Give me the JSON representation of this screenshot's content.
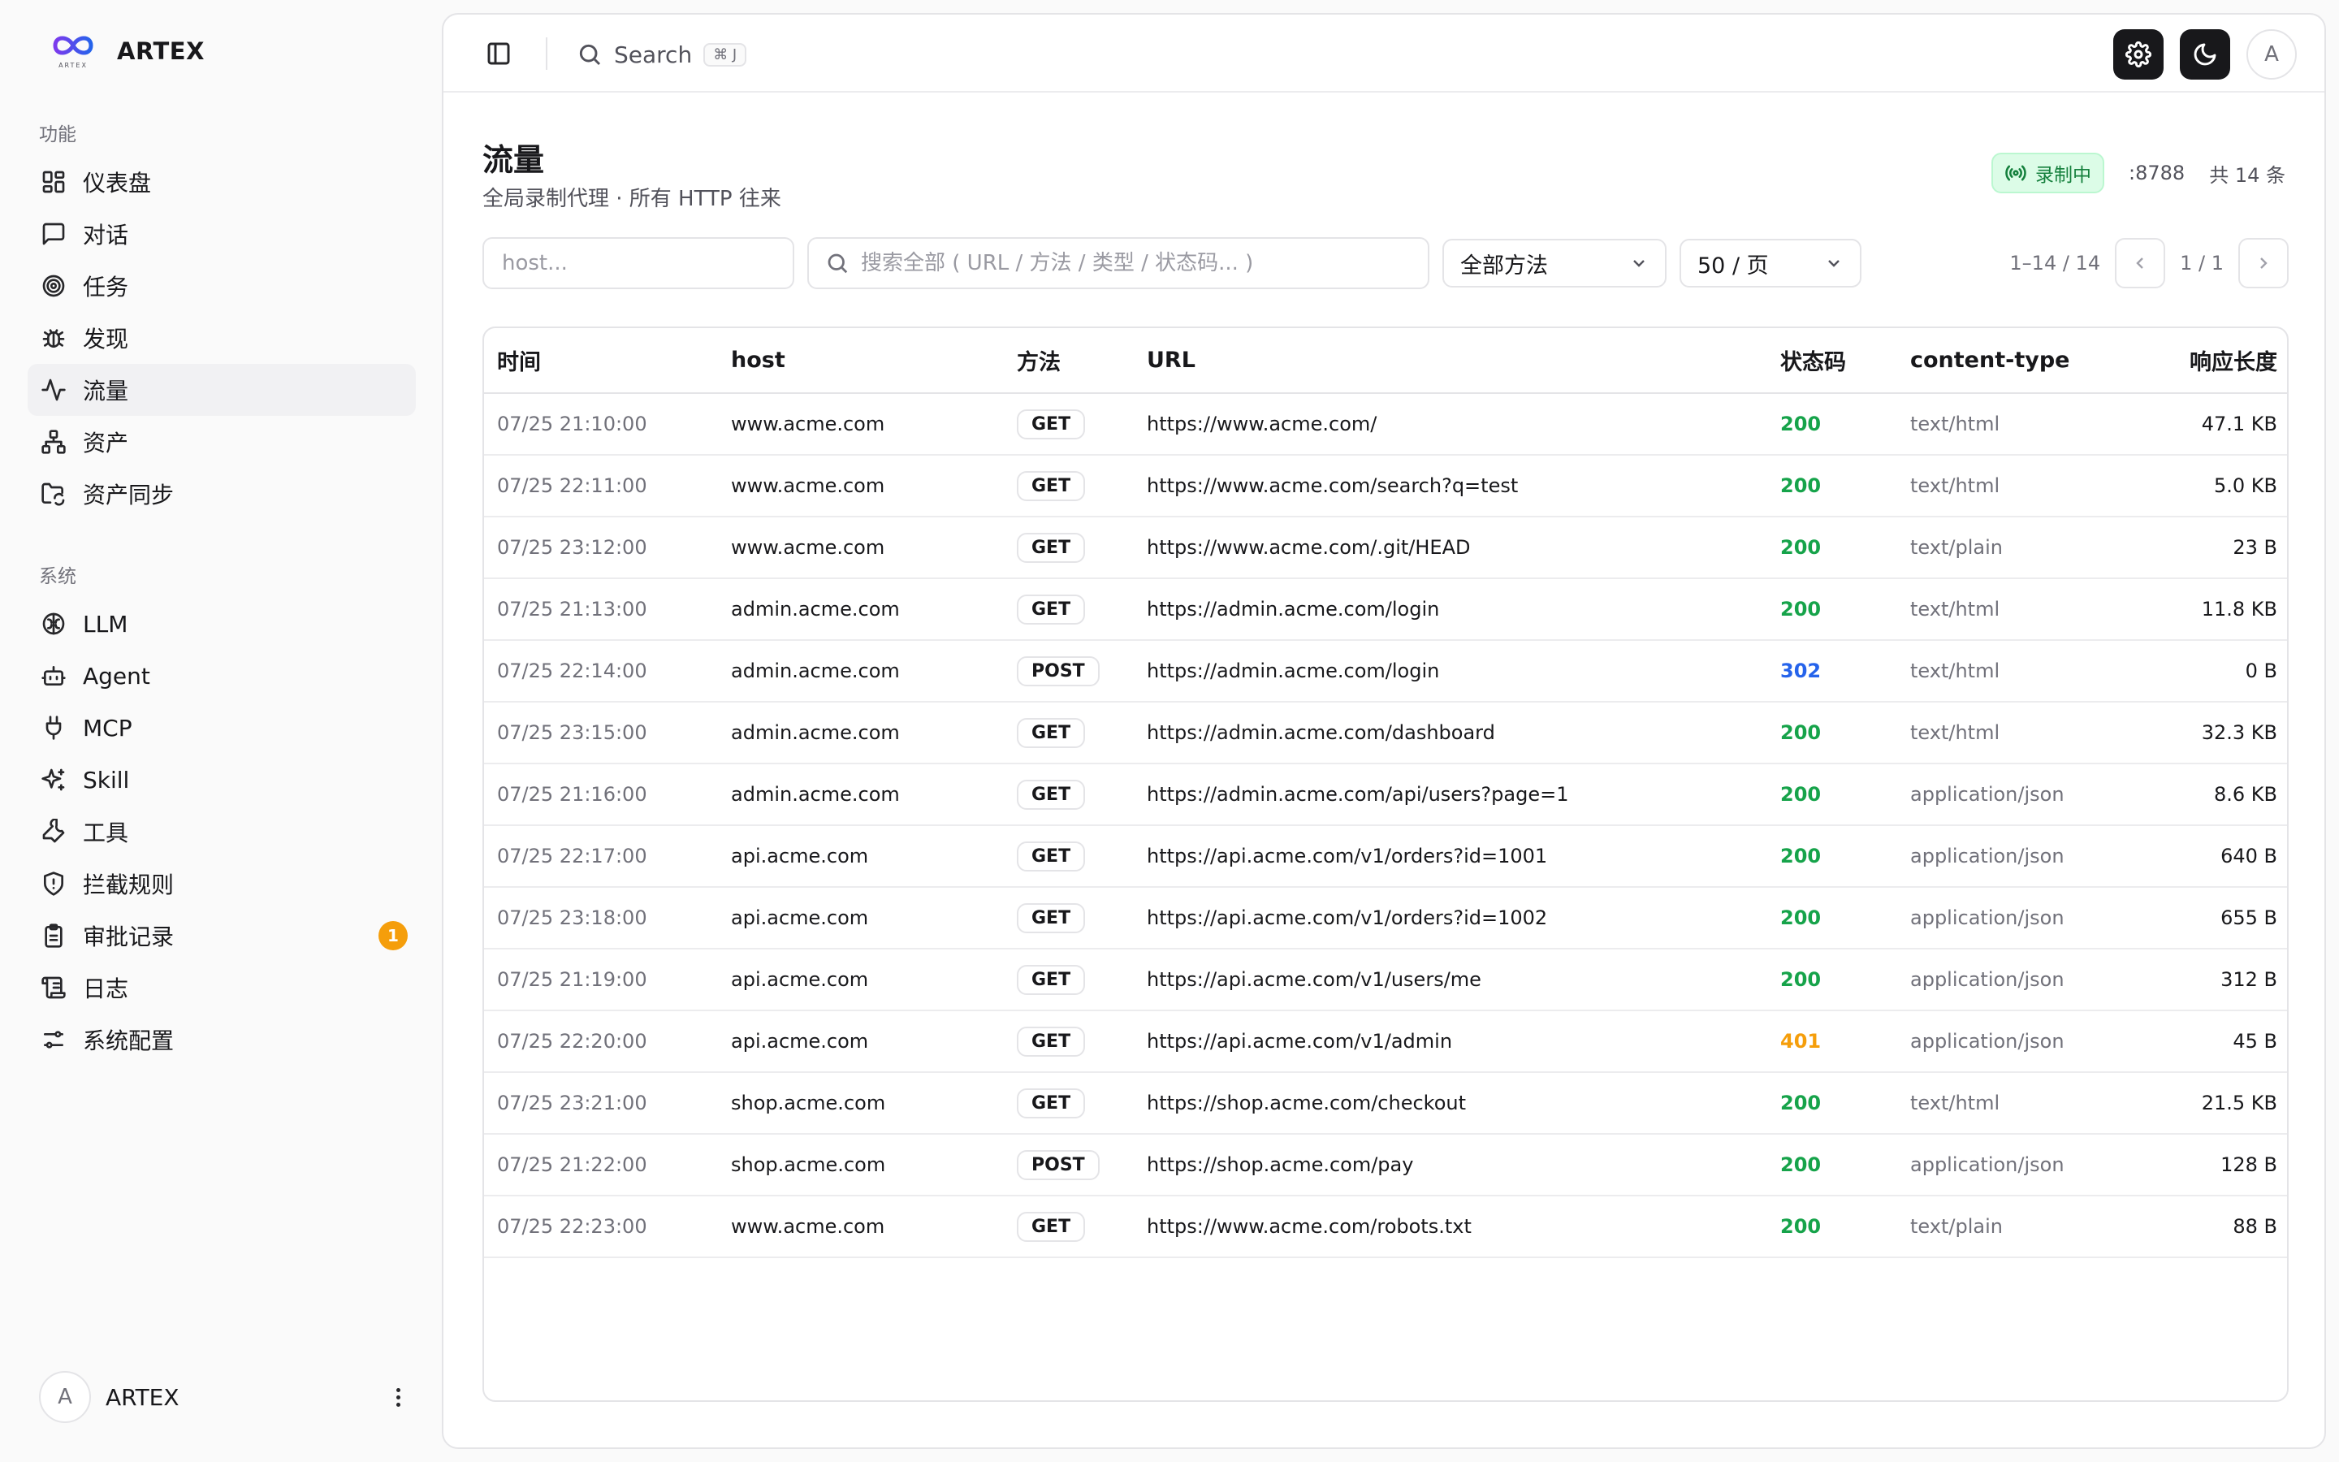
{
  "brand": {
    "name": "ARTEX",
    "logo_text": "ARTEX"
  },
  "sidebar": {
    "section_features": "功能",
    "features": [
      {
        "label": "仪表盘",
        "icon": "dashboard-icon"
      },
      {
        "label": "对话",
        "icon": "chat-icon"
      },
      {
        "label": "任务",
        "icon": "target-icon"
      },
      {
        "label": "发现",
        "icon": "bug-icon"
      },
      {
        "label": "流量",
        "icon": "activity-icon",
        "active": true
      },
      {
        "label": "资产",
        "icon": "network-icon"
      },
      {
        "label": "资产同步",
        "icon": "folder-sync-icon"
      }
    ],
    "section_system": "系统",
    "system": [
      {
        "label": "LLM",
        "icon": "brain-icon"
      },
      {
        "label": "Agent",
        "icon": "bot-icon"
      },
      {
        "label": "MCP",
        "icon": "plug-icon"
      },
      {
        "label": "Skill",
        "icon": "sparkles-icon"
      },
      {
        "label": "工具",
        "icon": "wrench-icon"
      },
      {
        "label": "拦截规则",
        "icon": "shield-icon"
      },
      {
        "label": "审批记录",
        "icon": "clipboard-icon",
        "badge": "1"
      },
      {
        "label": "日志",
        "icon": "scroll-icon"
      },
      {
        "label": "系统配置",
        "icon": "sliders-icon"
      }
    ],
    "user": {
      "avatar": "A",
      "name": "ARTEX"
    }
  },
  "topbar": {
    "search_label": "Search",
    "search_shortcut": "⌘ J",
    "avatar": "A"
  },
  "page": {
    "title": "流量",
    "subtitle": "全局录制代理 · 所有 HTTP 往来",
    "recording_label": "录制中",
    "port": ":8788",
    "total": "共 14 条"
  },
  "filters": {
    "host_placeholder": "host...",
    "search_placeholder": "搜索全部 ( URL / 方法 / 类型 / 状态码... )",
    "method_select": "全部方法",
    "page_size_select": "50 / 页",
    "range": "1–14 / 14",
    "page": "1 / 1"
  },
  "table": {
    "columns": [
      "时间",
      "host",
      "方法",
      "URL",
      "状态码",
      "content-type",
      "响应长度"
    ],
    "rows": [
      [
        "07/25 21:10:00",
        "www.acme.com",
        "GET",
        "https://www.acme.com/",
        "200",
        "text/html",
        "47.1 KB"
      ],
      [
        "07/25 22:11:00",
        "www.acme.com",
        "GET",
        "https://www.acme.com/search?q=test",
        "200",
        "text/html",
        "5.0 KB"
      ],
      [
        "07/25 23:12:00",
        "www.acme.com",
        "GET",
        "https://www.acme.com/.git/HEAD",
        "200",
        "text/plain",
        "23 B"
      ],
      [
        "07/25 21:13:00",
        "admin.acme.com",
        "GET",
        "https://admin.acme.com/login",
        "200",
        "text/html",
        "11.8 KB"
      ],
      [
        "07/25 22:14:00",
        "admin.acme.com",
        "POST",
        "https://admin.acme.com/login",
        "302",
        "text/html",
        "0 B"
      ],
      [
        "07/25 23:15:00",
        "admin.acme.com",
        "GET",
        "https://admin.acme.com/dashboard",
        "200",
        "text/html",
        "32.3 KB"
      ],
      [
        "07/25 21:16:00",
        "admin.acme.com",
        "GET",
        "https://admin.acme.com/api/users?page=1",
        "200",
        "application/json",
        "8.6 KB"
      ],
      [
        "07/25 22:17:00",
        "api.acme.com",
        "GET",
        "https://api.acme.com/v1/orders?id=1001",
        "200",
        "application/json",
        "640 B"
      ],
      [
        "07/25 23:18:00",
        "api.acme.com",
        "GET",
        "https://api.acme.com/v1/orders?id=1002",
        "200",
        "application/json",
        "655 B"
      ],
      [
        "07/25 21:19:00",
        "api.acme.com",
        "GET",
        "https://api.acme.com/v1/users/me",
        "200",
        "application/json",
        "312 B"
      ],
      [
        "07/25 22:20:00",
        "api.acme.com",
        "GET",
        "https://api.acme.com/v1/admin",
        "401",
        "application/json",
        "45 B"
      ],
      [
        "07/25 23:21:00",
        "shop.acme.com",
        "GET",
        "https://shop.acme.com/checkout",
        "200",
        "text/html",
        "21.5 KB"
      ],
      [
        "07/25 21:22:00",
        "shop.acme.com",
        "POST",
        "https://shop.acme.com/pay",
        "200",
        "application/json",
        "128 B"
      ],
      [
        "07/25 22:23:00",
        "www.acme.com",
        "GET",
        "https://www.acme.com/robots.txt",
        "200",
        "text/plain",
        "88 B"
      ]
    ]
  },
  "colors": {
    "status_2xx": "#16a34a",
    "status_3xx": "#2563eb",
    "status_4xx": "#f59e0b",
    "accent_dark": "#18181b",
    "recording_green": "#15803d"
  }
}
